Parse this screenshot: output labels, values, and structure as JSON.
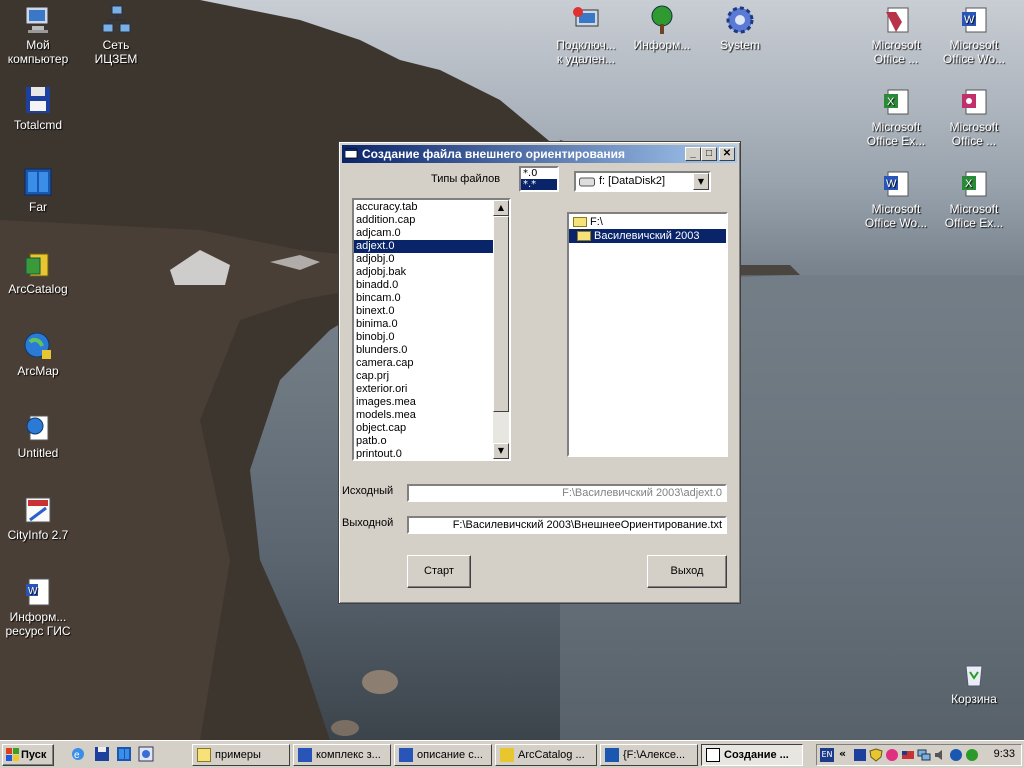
{
  "desktop": {
    "icons_left": [
      {
        "label": "Мой\nкомпьютер",
        "icon": "computer-icon"
      },
      {
        "label": "Сеть\nИЦЗЕМ",
        "icon": "network-icon"
      },
      {
        "label": "Totalcmd",
        "icon": "floppy-icon"
      },
      {
        "label": "Far",
        "icon": "far-icon"
      },
      {
        "label": "ArcCatalog",
        "icon": "arccatalog-icon"
      },
      {
        "label": "ArcMap",
        "icon": "arcmap-icon"
      },
      {
        "label": "Untitled",
        "icon": "globe-document-icon"
      },
      {
        "label": "CityInfo 2.7",
        "icon": "cityinfo-icon"
      },
      {
        "label": "Информ...\nресурс ГИС",
        "icon": "word-document-icon"
      }
    ],
    "icons_top": [
      {
        "label": "Подключ...\nк удален...",
        "icon": "remote-desktop-icon"
      },
      {
        "label": "Информ...",
        "icon": "tree-icon"
      },
      {
        "label": "System",
        "icon": "gear-icon"
      }
    ],
    "icons_right": [
      {
        "label": "Microsoft\nOffice ...",
        "icon": "access-icon"
      },
      {
        "label": "Microsoft\nOffice Wo...",
        "icon": "word-icon"
      },
      {
        "label": "Microsoft\nOffice Ex...",
        "icon": "excel-icon"
      },
      {
        "label": "Microsoft\nOffice ...",
        "icon": "key-icon"
      },
      {
        "label": "Microsoft\nOffice Wo...",
        "icon": "word-icon"
      },
      {
        "label": "Microsoft\nOffice Ex...",
        "icon": "excel-icon"
      }
    ],
    "recycle": {
      "label": "Корзина",
      "icon": "recycle-bin-icon"
    }
  },
  "dialog": {
    "title": "Создание файла внешнего ориентирования",
    "file_types_label": "Типы файлов",
    "file_types": [
      "*.0",
      "*.*"
    ],
    "drive": "f: [DataDisk2]",
    "files": [
      "accuracy.tab",
      "addition.cap",
      "adjcam.0",
      "adjext.0",
      "adjobj.0",
      "adjobj.bak",
      "binadd.0",
      "bincam.0",
      "binext.0",
      "binima.0",
      "binobj.0",
      "blunders.0",
      "camera.cap",
      "cap.prj",
      "exterior.ori",
      "images.mea",
      "models.mea",
      "object.cap",
      "patb.o",
      "printout.0"
    ],
    "selected_file_index": 3,
    "dirs": [
      "F:\\",
      "Василевичский 2003"
    ],
    "selected_dir_index": 1,
    "source_label": "Исходный",
    "source_value": "F:\\Василевичский 2003\\adjext.0",
    "output_label": "Выходной",
    "output_value": "F:\\Василевичский 2003\\ВнешнееОриентирование.txt",
    "start_button": "Старт",
    "exit_button": "Выход"
  },
  "taskbar": {
    "start": "Пуск",
    "tasks": [
      "примеры",
      "комплекс з...",
      "описание с...",
      "ArcCatalog ...",
      "{F:\\Алексе...",
      "Создание ..."
    ],
    "active_task_index": 5,
    "lang": "EN",
    "time": "9:33"
  },
  "colors": {
    "selection": "#0a246a",
    "titlebar_start": "#0a246a",
    "titlebar_end": "#a6caf0",
    "face": "#d4d0c8"
  }
}
